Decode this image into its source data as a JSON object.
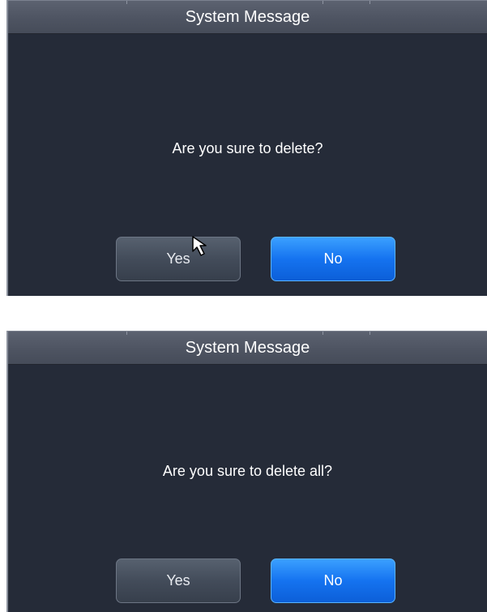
{
  "dialogs": [
    {
      "title": "System Message",
      "message": "Are you sure to delete?",
      "yes_label": "Yes",
      "no_label": "No"
    },
    {
      "title": "System Message",
      "message": "Are you sure to delete all?",
      "yes_label": "Yes",
      "no_label": "No"
    }
  ],
  "colors": {
    "dialog_bg": "#252b38",
    "titlebar_bg": "#4e5462",
    "yes_button_bg": "#434c5a",
    "no_button_bg": "#1573f0",
    "text": "#ffffff"
  },
  "icons": {
    "pointer": "mouse-pointer-icon"
  }
}
